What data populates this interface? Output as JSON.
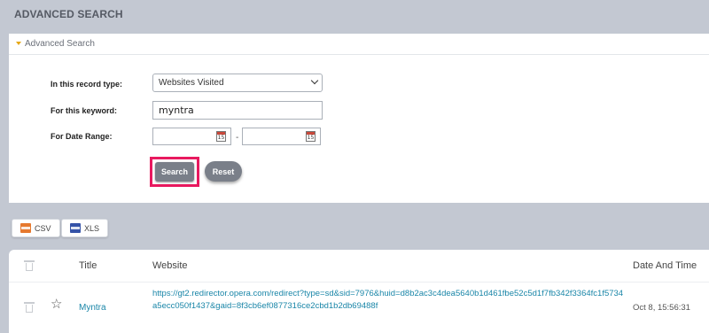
{
  "page_title": "ADVANCED SEARCH",
  "panel": {
    "header": "Advanced Search",
    "record_type_label": "In this record type:",
    "record_type_value": "Websites Visited",
    "keyword_label": "For this keyword:",
    "keyword_value": "myntra",
    "date_range_label": "For Date Range:",
    "date_separator": "-",
    "calendar_icon_text": "15",
    "search_label": "Search",
    "reset_label": "Reset"
  },
  "export": {
    "csv_label": "CSV",
    "xls_label": "XLS"
  },
  "table": {
    "columns": {
      "title": "Title",
      "website": "Website",
      "date_time": "Date And Time"
    },
    "rows": [
      {
        "title": "Myntra",
        "website": "https://gt2.redirector.opera.com/redirect?type=sd&sid=7976&huid=d8b2ac3c4dea5640b1d461fbe52c5d1f7fb342f3364fc1f5734a5ecc050f1437&gaid=8f3cb6ef0877316ce2cbd1b2db69488f",
        "date_time": "Oct 8, 15:56:31"
      }
    ]
  },
  "colors": {
    "accent_outline": "#e8195f",
    "link": "#1a86a8",
    "button": "#7a7f89"
  }
}
